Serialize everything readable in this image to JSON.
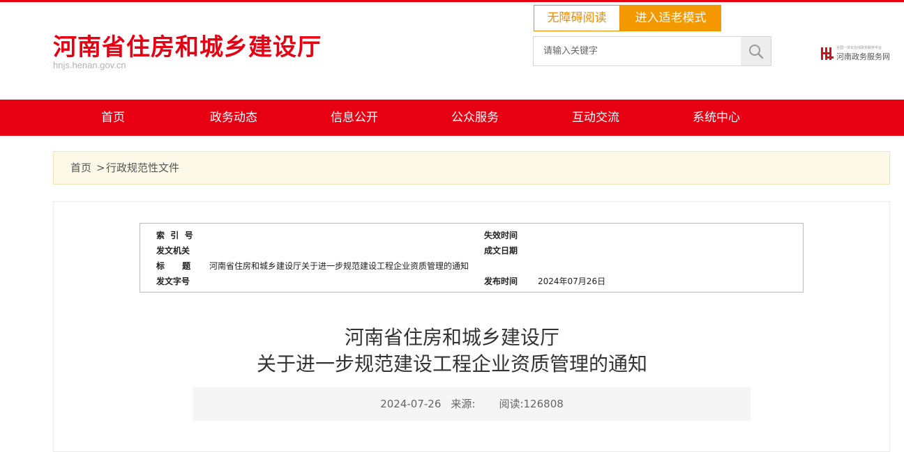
{
  "header": {
    "site_title": "河南省住房和城乡建设厅",
    "site_domain": "hnjs.henan.gov.cn",
    "accessibility_label": "无障碍阅读",
    "elder_mode_label": "进入适老模式",
    "search_placeholder": "请输入关键字",
    "gov_portal_small": "全国一体化在线政务服务平台",
    "gov_portal_label": "河南政务服务网"
  },
  "nav": {
    "items": [
      "首页",
      "政务动态",
      "信息公开",
      "公众服务",
      "互动交流",
      "系统中心"
    ]
  },
  "breadcrumb": {
    "home": "首页",
    "separator": ">",
    "current": "行政规范性文件"
  },
  "metadata": {
    "index_no_label": "索  引  号",
    "index_no_value": "",
    "expiry_label": "失效时间",
    "expiry_value": "",
    "issuer_label": "发文机关",
    "issuer_value": "",
    "written_date_label": "成文日期",
    "written_date_value": "",
    "title_label": "标      题",
    "title_value": "河南省住房和城乡建设厅关于进一步规范建设工程企业资质管理的通知",
    "doc_no_label": "发文字号",
    "doc_no_value": "",
    "publish_label": "发布时间",
    "publish_value": "2024年07月26日"
  },
  "article": {
    "title_line1": "河南省住房和城乡建设厅",
    "title_line2": "关于进一步规范建设工程企业资质管理的通知",
    "date": "2024-07-26",
    "source_label": "来源:",
    "source_value": "",
    "reads_label": "阅读:",
    "reads_value": "126808"
  },
  "colors": {
    "brand_red": "#e60012",
    "accent_orange": "#f39800",
    "breadcrumb_bg": "#fdf9e8"
  }
}
